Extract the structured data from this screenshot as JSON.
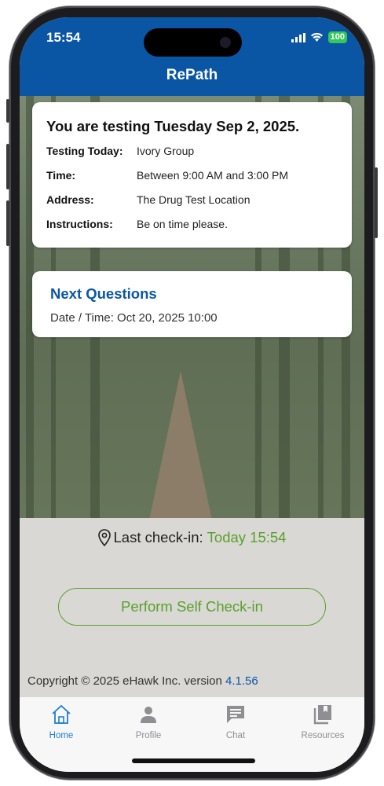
{
  "status_bar": {
    "time": "15:54",
    "battery": "100"
  },
  "app": {
    "title": "RePath"
  },
  "testing_card": {
    "title": "You are testing Tuesday Sep 2, 2025.",
    "rows": [
      {
        "label": "Testing Today:",
        "value": "Ivory Group"
      },
      {
        "label": "Time:",
        "value": "Between 9:00 AM and 3:00 PM"
      },
      {
        "label": "Address:",
        "value": "The Drug Test Location"
      },
      {
        "label": "Instructions:",
        "value": "Be on time please."
      }
    ]
  },
  "next_questions": {
    "title": "Next Questions",
    "date_time": "Date / Time: Oct 20, 2025 10:00"
  },
  "checkin": {
    "label": "Last check-in:",
    "value": "Today 15:54",
    "button": "Perform Self Check-in"
  },
  "footer": {
    "copyright": "Copyright © 2025 eHawk Inc. version ",
    "version": "4.1.56"
  },
  "tabs": [
    {
      "label": "Home",
      "icon": "home-icon",
      "active": true
    },
    {
      "label": "Profile",
      "icon": "person-icon",
      "active": false
    },
    {
      "label": "Chat",
      "icon": "chat-icon",
      "active": false
    },
    {
      "label": "Resources",
      "icon": "book-icon",
      "active": false
    }
  ],
  "colors": {
    "header": "#0a56a5",
    "accent_green": "#5aa02c",
    "active_tab": "#1f7fd1",
    "inactive_tab": "#8e8e93"
  }
}
